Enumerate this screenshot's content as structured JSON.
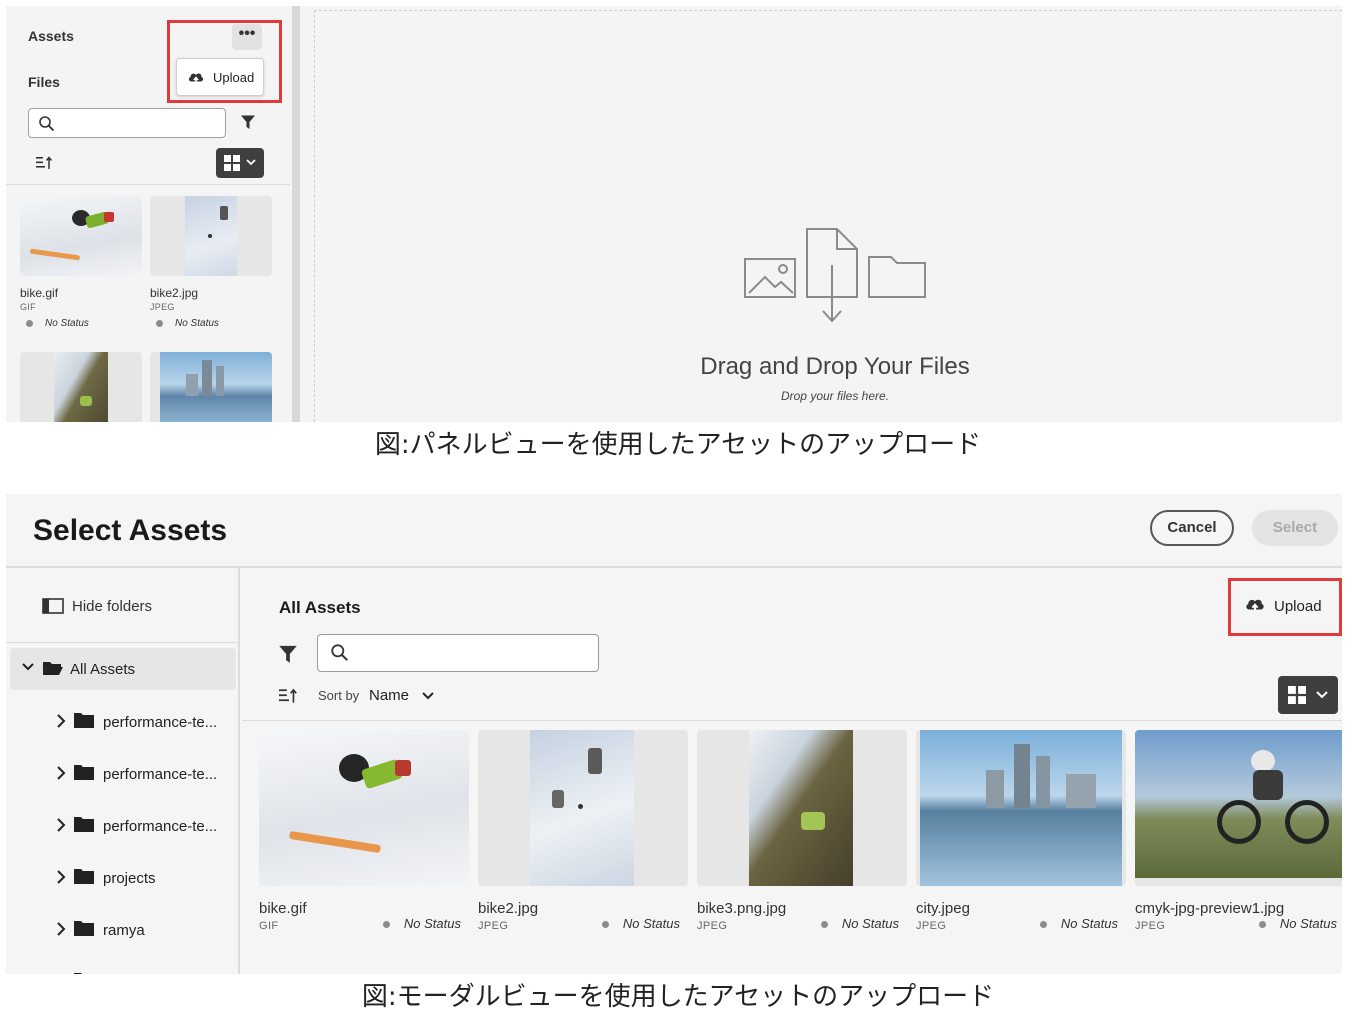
{
  "panel": {
    "assets_label": "Assets",
    "files_label": "Files",
    "more_label": "•••",
    "upload_label": "Upload",
    "search_placeholder": "",
    "cards": [
      {
        "name": "bike.gif",
        "type": "GIF",
        "status": "No Status"
      },
      {
        "name": "bike2.jpg",
        "type": "JPEG",
        "status": "No Status"
      }
    ],
    "drop_title": "Drag and Drop Your Files",
    "drop_subtitle": "Drop your files here."
  },
  "caption_top": "図:パネルビューを使用したアセットのアップロード",
  "modal": {
    "title": "Select Assets",
    "cancel_label": "Cancel",
    "select_label": "Select",
    "hide_folders_label": "Hide folders",
    "root_folder": "All Assets",
    "folders": [
      "performance-te...",
      "performance-te...",
      "performance-te...",
      "projects",
      "ramya"
    ],
    "main_title": "All Assets",
    "upload_label": "Upload",
    "search_placeholder": "",
    "sort_by_label": "Sort by",
    "sort_value": "Name",
    "cards": [
      {
        "name": "bike.gif",
        "type": "GIF",
        "status": "No Status"
      },
      {
        "name": "bike2.jpg",
        "type": "JPEG",
        "status": "No Status"
      },
      {
        "name": "bike3.png.jpg",
        "type": "JPEG",
        "status": "No Status"
      },
      {
        "name": "city.jpeg",
        "type": "JPEG",
        "status": "No Status"
      },
      {
        "name": "cmyk-jpg-preview1.jpg",
        "type": "JPEG",
        "status": "No Status"
      }
    ]
  },
  "caption_bottom": "図:モーダルビューを使用したアセットのアップロード",
  "colors": {
    "highlight": "#e03a3a",
    "dark_button": "#3f3f3f",
    "panel_bg": "#f4f4f4"
  }
}
